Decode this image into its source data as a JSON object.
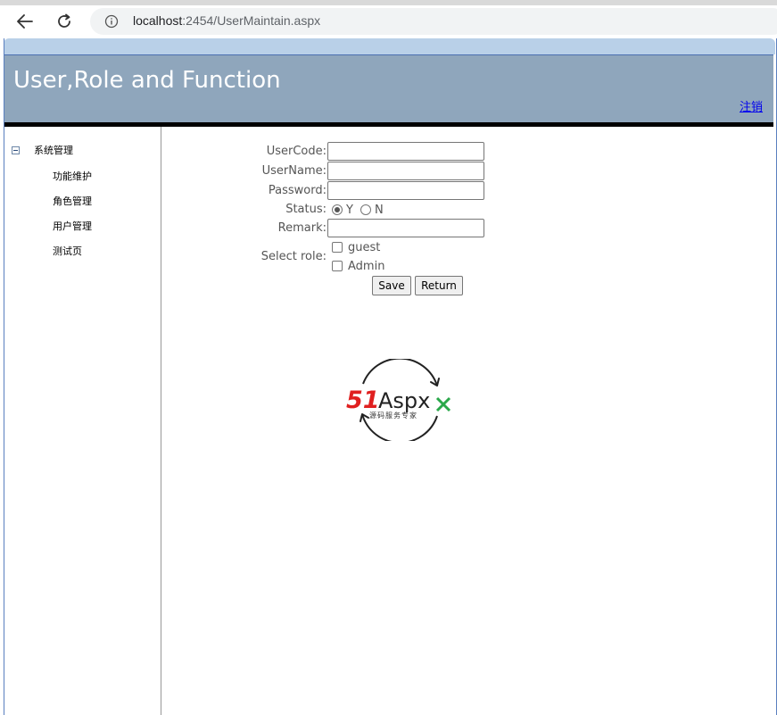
{
  "browser": {
    "url_host": "localhost",
    "url_rest": ":2454/UserMaintain.aspx"
  },
  "header": {
    "title": "User,Role and Function",
    "logout_label": "注销"
  },
  "sidebar": {
    "root_label": "系统管理",
    "items": [
      {
        "label": "功能维护"
      },
      {
        "label": "角色管理"
      },
      {
        "label": "用户管理"
      },
      {
        "label": "测试页"
      }
    ]
  },
  "form": {
    "usercode_label": "UserCode:",
    "usercode_value": "",
    "username_label": "UserName:",
    "username_value": "",
    "password_label": "Password:",
    "password_value": "",
    "status_label": "Status:",
    "status_options": [
      "Y",
      "N"
    ],
    "status_selected": "Y",
    "remark_label": "Remark:",
    "remark_value": "",
    "select_role_label": "Select role:",
    "roles": [
      {
        "label": "guest",
        "checked": false
      },
      {
        "label": "Admin",
        "checked": false
      }
    ],
    "save_label": "Save",
    "return_label": "Return"
  },
  "logo": {
    "brand_51": "51",
    "brand_aspx": "Aspx",
    "tagline": "源码服务专家",
    "colors": {
      "red": "#e02020",
      "green": "#2aa84a",
      "dark": "#222222"
    }
  }
}
